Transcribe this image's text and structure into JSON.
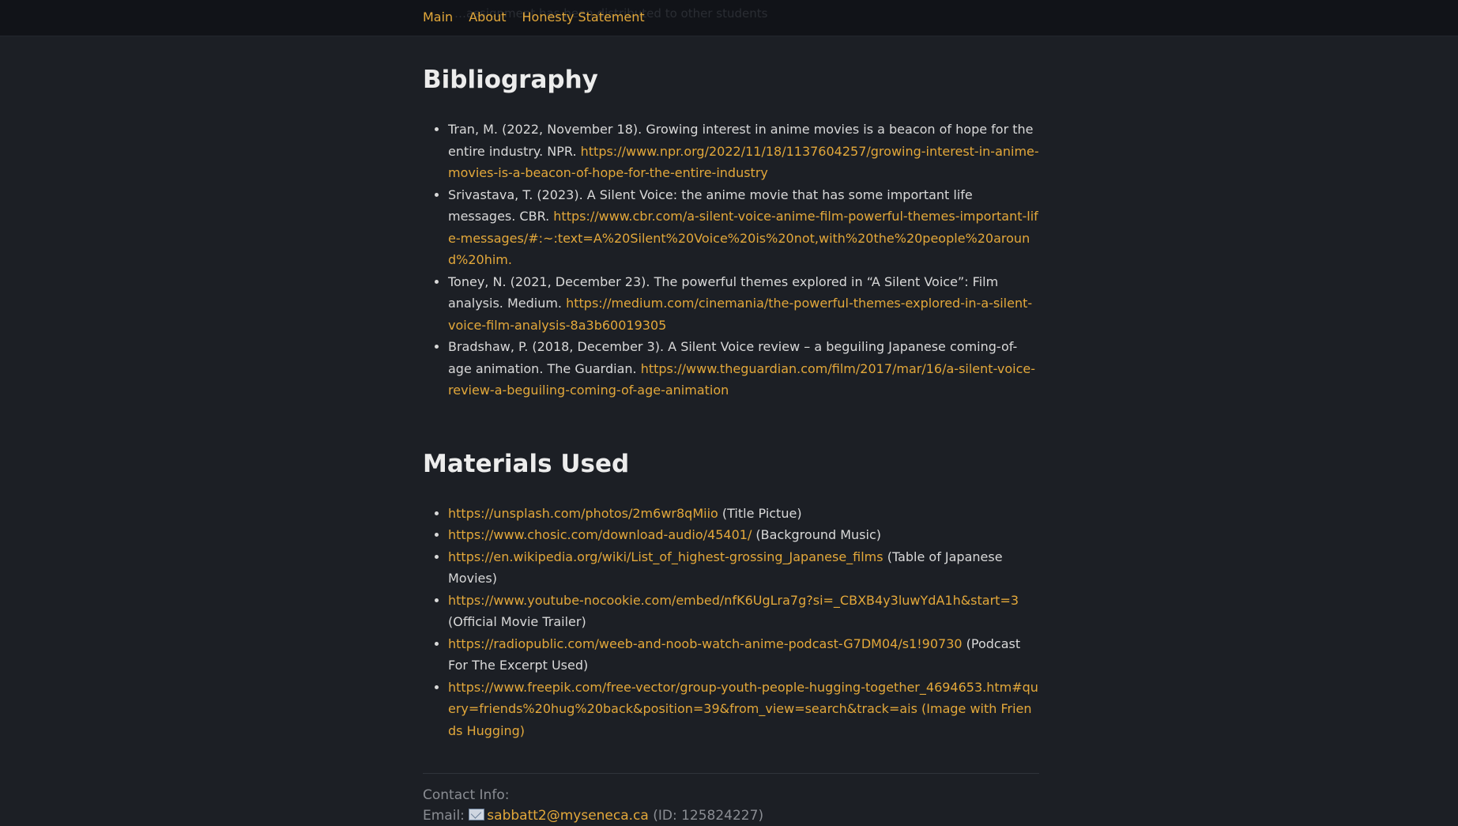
{
  "nav": {
    "items": [
      "Main",
      "About",
      "Honesty Statement"
    ],
    "ghost_text": "…assignment has been distributed to other students"
  },
  "bibliography": {
    "heading": "Bibliography",
    "entries": [
      {
        "text": "Tran, M. (2022, November 18). Growing interest in anime movies is a beacon of hope for the entire industry. NPR. ",
        "url": "https://www.npr.org/2022/11/18/1137604257/growing-interest-in-anime-movies-is-a-beacon-of-hope-for-the-entire-industry"
      },
      {
        "text": "Srivastava, T. (2023). A Silent Voice: the anime movie that has some important life messages. CBR. ",
        "url": "https://www.cbr.com/a-silent-voice-anime-film-powerful-themes-important-life-messages/#:~:text=A%20Silent%20Voice%20is%20not,with%20the%20people%20around%20him."
      },
      {
        "text": "Toney, N. (2021, December 23). The powerful themes explored in “A Silent Voice”: Film analysis. Medium. ",
        "url": "https://medium.com/cinemania/the-powerful-themes-explored-in-a-silent-voice-film-analysis-8a3b60019305"
      },
      {
        "text": "Bradshaw, P. (2018, December 3). A Silent Voice review – a beguiling Japanese coming-of-age animation. The Guardian. ",
        "url": "https://www.theguardian.com/film/2017/mar/16/a-silent-voice-review-a-beguiling-coming-of-age-animation"
      }
    ]
  },
  "materials": {
    "heading": "Materials Used",
    "entries": [
      {
        "url": "https://unsplash.com/photos/2m6wr8qMiio",
        "note": " (Title Pictue)"
      },
      {
        "url": "https://www.chosic.com/download-audio/45401/",
        "note": " (Background Music)"
      },
      {
        "url": "https://en.wikipedia.org/wiki/List_of_highest-grossing_Japanese_films",
        "note": " (Table of Japanese Movies)"
      },
      {
        "url": "https://www.youtube-nocookie.com/embed/nfK6UgLra7g?si=_CBXB4y3luwYdA1h&start=3",
        "note": " (Official Movie Trailer)"
      },
      {
        "url": "https://radiopublic.com/weeb-and-noob-watch-anime-podcast-G7DM04/s1!90730",
        "note": " (Podcast For The Excerpt Used)"
      },
      {
        "url": "https://www.freepik.com/free-vector/group-youth-people-hugging-together_4694653.htm#query=friends%20hug%20back&position=39&from_view=search&track=ais (Image with Friends Hugging)",
        "note": ""
      }
    ]
  },
  "contact": {
    "label": "Contact Info:",
    "email_label": "Email: ",
    "email_icon": "envelope-icon",
    "email": "sabbatt2@myseneca.ca",
    "id_text": " (ID: 125824227)"
  }
}
